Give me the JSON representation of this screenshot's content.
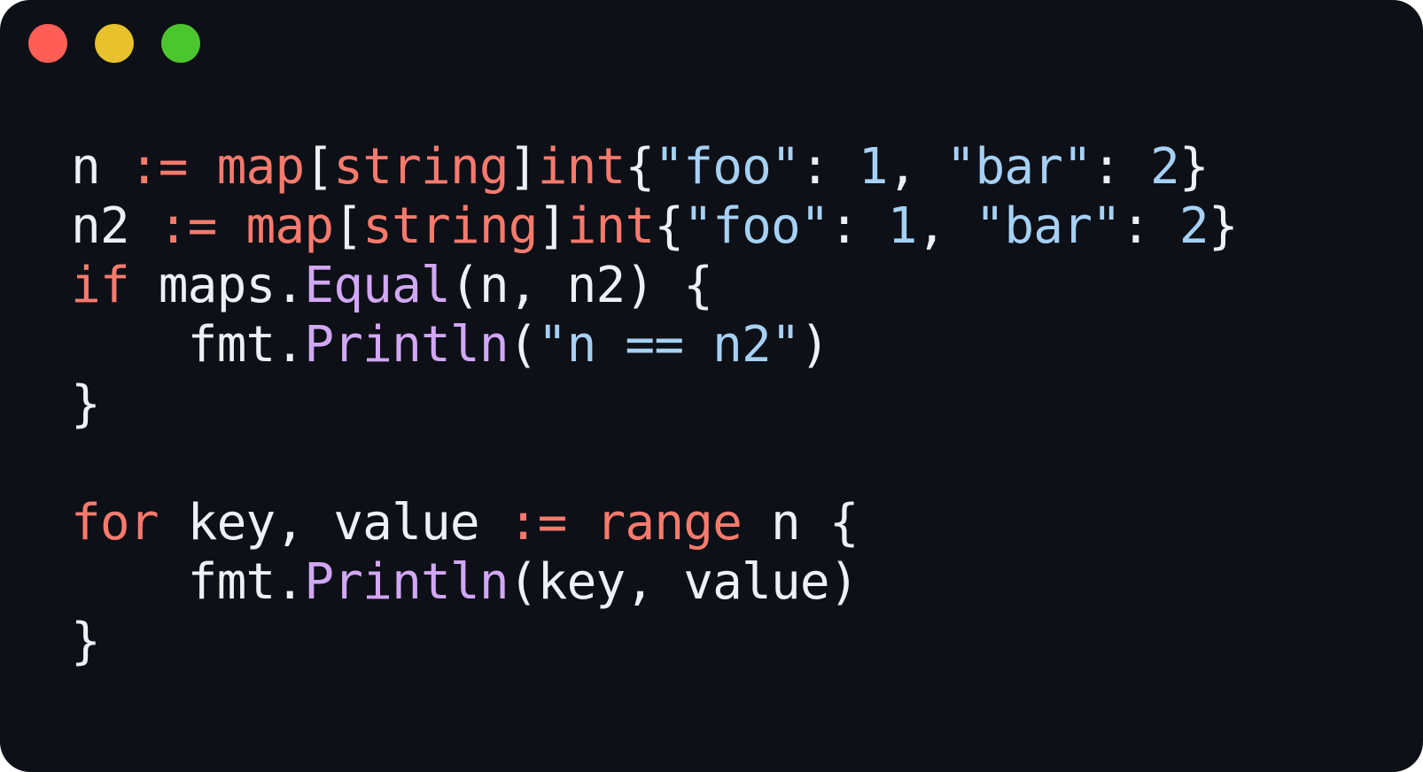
{
  "window": {
    "traffic_lights": [
      {
        "name": "close-dot",
        "color": "#ff5f57"
      },
      {
        "name": "minimize-dot",
        "color": "#e8c22d"
      },
      {
        "name": "maximize-dot",
        "color": "#4cc62f"
      }
    ]
  },
  "colors": {
    "background": "#0d1017",
    "default": "#eef0f5",
    "keyword": "#f87a6d",
    "function": "#d2a7f5",
    "literal": "#a6d1f4"
  },
  "code": {
    "lines": [
      [
        {
          "text": "n ",
          "kind": "default"
        },
        {
          "text": ":=",
          "kind": "keyword"
        },
        {
          "text": " ",
          "kind": "default"
        },
        {
          "text": "map",
          "kind": "keyword"
        },
        {
          "text": "[",
          "kind": "default"
        },
        {
          "text": "string",
          "kind": "keyword"
        },
        {
          "text": "]",
          "kind": "default"
        },
        {
          "text": "int",
          "kind": "keyword"
        },
        {
          "text": "{",
          "kind": "default"
        },
        {
          "text": "\"foo\"",
          "kind": "literal"
        },
        {
          "text": ": ",
          "kind": "default"
        },
        {
          "text": "1",
          "kind": "literal"
        },
        {
          "text": ", ",
          "kind": "default"
        },
        {
          "text": "\"bar\"",
          "kind": "literal"
        },
        {
          "text": ": ",
          "kind": "default"
        },
        {
          "text": "2",
          "kind": "literal"
        },
        {
          "text": "}",
          "kind": "default"
        }
      ],
      [
        {
          "text": "n2 ",
          "kind": "default"
        },
        {
          "text": ":=",
          "kind": "keyword"
        },
        {
          "text": " ",
          "kind": "default"
        },
        {
          "text": "map",
          "kind": "keyword"
        },
        {
          "text": "[",
          "kind": "default"
        },
        {
          "text": "string",
          "kind": "keyword"
        },
        {
          "text": "]",
          "kind": "default"
        },
        {
          "text": "int",
          "kind": "keyword"
        },
        {
          "text": "{",
          "kind": "default"
        },
        {
          "text": "\"foo\"",
          "kind": "literal"
        },
        {
          "text": ": ",
          "kind": "default"
        },
        {
          "text": "1",
          "kind": "literal"
        },
        {
          "text": ", ",
          "kind": "default"
        },
        {
          "text": "\"bar\"",
          "kind": "literal"
        },
        {
          "text": ": ",
          "kind": "default"
        },
        {
          "text": "2",
          "kind": "literal"
        },
        {
          "text": "}",
          "kind": "default"
        }
      ],
      [
        {
          "text": "if",
          "kind": "keyword"
        },
        {
          "text": " maps.",
          "kind": "default"
        },
        {
          "text": "Equal",
          "kind": "function"
        },
        {
          "text": "(n, n2) {",
          "kind": "default"
        }
      ],
      [
        {
          "text": "    fmt.",
          "kind": "default"
        },
        {
          "text": "Println",
          "kind": "function"
        },
        {
          "text": "(",
          "kind": "default"
        },
        {
          "text": "\"n == n2\"",
          "kind": "literal"
        },
        {
          "text": ")",
          "kind": "default"
        }
      ],
      [
        {
          "text": "}",
          "kind": "default"
        }
      ],
      [],
      [
        {
          "text": "for",
          "kind": "keyword"
        },
        {
          "text": " key, value ",
          "kind": "default"
        },
        {
          "text": ":=",
          "kind": "keyword"
        },
        {
          "text": " ",
          "kind": "default"
        },
        {
          "text": "range",
          "kind": "keyword"
        },
        {
          "text": " n {",
          "kind": "default"
        }
      ],
      [
        {
          "text": "    fmt.",
          "kind": "default"
        },
        {
          "text": "Println",
          "kind": "function"
        },
        {
          "text": "(key, value)",
          "kind": "default"
        }
      ],
      [
        {
          "text": "}",
          "kind": "default"
        }
      ]
    ]
  }
}
